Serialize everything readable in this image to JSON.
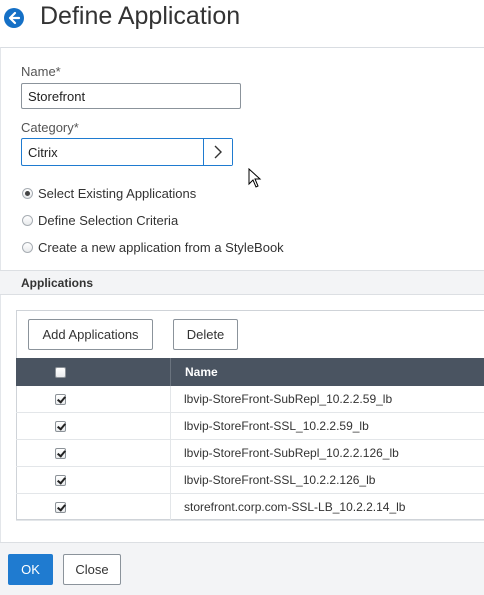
{
  "header": {
    "title": "Define Application",
    "back_icon": "back-arrow-icon"
  },
  "form": {
    "name_label": "Name*",
    "name_value": "Storefront",
    "category_label": "Category*",
    "category_value": "Citrix",
    "category_button_icon": "chevron-right-icon"
  },
  "radio_options": [
    {
      "label": "Select Existing Applications",
      "checked": true
    },
    {
      "label": "Define Selection Criteria",
      "checked": false
    },
    {
      "label": "Create a new application from a StyleBook",
      "checked": false
    }
  ],
  "applications": {
    "section_title": "Applications",
    "add_button": "Add Applications",
    "delete_button": "Delete",
    "columns": [
      "",
      "Name"
    ],
    "rows": [
      {
        "checked": true,
        "name": "lbvip-StoreFront-SubRepl_10.2.2.59_lb"
      },
      {
        "checked": true,
        "name": "lbvip-StoreFront-SSL_10.2.2.59_lb"
      },
      {
        "checked": true,
        "name": "lbvip-StoreFront-SubRepl_10.2.2.126_lb"
      },
      {
        "checked": true,
        "name": "lbvip-StoreFront-SSL_10.2.2.126_lb"
      },
      {
        "checked": true,
        "name": "storefront.corp.com-SSL-LB_10.2.2.14_lb"
      }
    ]
  },
  "footer": {
    "ok_button": "OK",
    "close_button": "Close"
  },
  "colors": {
    "accent": "#1f7bd0",
    "table_header": "#4a5461"
  }
}
